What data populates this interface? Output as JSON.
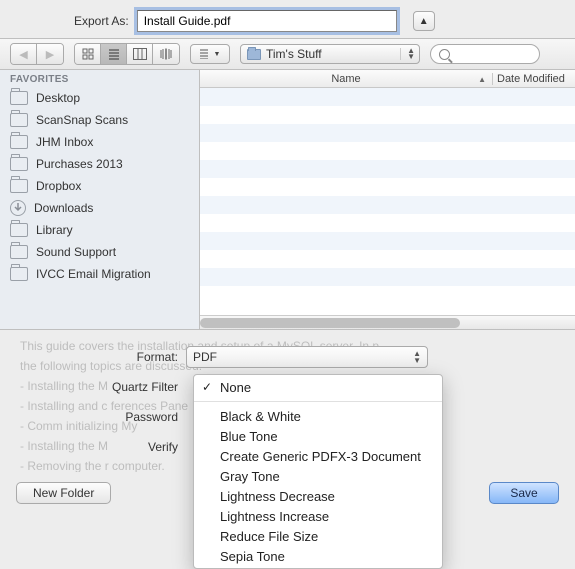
{
  "header": {
    "export_label": "Export As:",
    "filename": "Install Guide.pdf"
  },
  "toolbar": {
    "location": "Tim's Stuff"
  },
  "sidebar": {
    "section": "FAVORITES",
    "items": [
      {
        "label": "Desktop",
        "type": "folder"
      },
      {
        "label": "ScanSnap Scans",
        "type": "folder"
      },
      {
        "label": "JHM Inbox",
        "type": "folder"
      },
      {
        "label": "Purchases 2013",
        "type": "folder"
      },
      {
        "label": "Dropbox",
        "type": "folder"
      },
      {
        "label": "Downloads",
        "type": "download"
      },
      {
        "label": "Library",
        "type": "folder"
      },
      {
        "label": "Sound Support",
        "type": "folder"
      },
      {
        "label": "IVCC Email Migration",
        "type": "folder"
      }
    ]
  },
  "columns": {
    "name": "Name",
    "date_modified": "Date Modified"
  },
  "form": {
    "format_label": "Format:",
    "format_value": "PDF",
    "quartz_label": "Quartz Filter",
    "password_label": "Password",
    "verify_label": "Verify"
  },
  "popup": {
    "selected": "None",
    "items": [
      "Black & White",
      "Blue Tone",
      "Create Generic PDFX-3 Document",
      "Gray Tone",
      "Lightness Decrease",
      "Lightness Increase",
      "Reduce File Size",
      "Sepia Tone"
    ]
  },
  "buttons": {
    "new_folder": "New Folder",
    "save": "Save"
  },
  "bg_text": "This guide covers the installation and setup of a MySQL server. In p\nthe following topics are discussed:\n- Installing the M\n- Installing and c                                                       ferences Pane\n- Comm                                                            initializing My\n- Installing the M\n- Removing the                                                      r computer.\n\nTo dup track of\nplease read the"
}
